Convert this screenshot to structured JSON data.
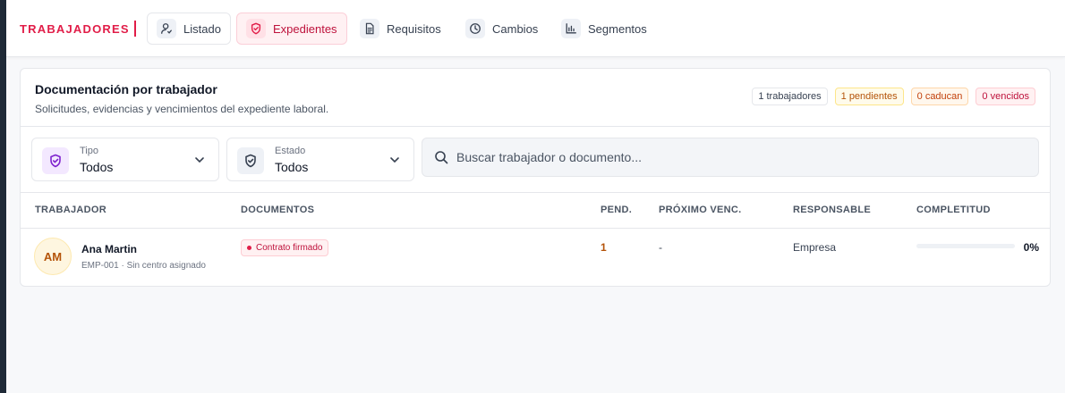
{
  "nav": {
    "brand": "TRABAJADORES",
    "tabs": [
      {
        "label": "Listado",
        "icon": "user-check-icon"
      },
      {
        "label": "Expedientes",
        "icon": "shield-icon",
        "active": true
      },
      {
        "label": "Requisitos",
        "icon": "document-icon"
      },
      {
        "label": "Cambios",
        "icon": "clock-icon"
      },
      {
        "label": "Segmentos",
        "icon": "bar-chart-icon"
      }
    ]
  },
  "card": {
    "title": "Documentación por trabajador",
    "subtitle": "Solicitudes, evidencias y vencimientos del expediente laboral.",
    "badges": {
      "workers": "1 trabajadores",
      "pending": "1 pendientes",
      "expiring": "0 caducan",
      "expired": "0 vencidos"
    }
  },
  "filters": {
    "tipo": {
      "label": "Tipo",
      "value": "Todos"
    },
    "estado": {
      "label": "Estado",
      "value": "Todos"
    },
    "search_placeholder": "Buscar trabajador o documento..."
  },
  "table": {
    "headers": {
      "worker": "TRABAJADOR",
      "documents": "DOCUMENTOS",
      "pending": "PEND.",
      "next_due": "PRÓXIMO VENC.",
      "responsible": "RESPONSABLE",
      "completeness": "COMPLETITUD"
    },
    "rows": [
      {
        "initials": "AM",
        "name": "Ana Martin",
        "sub": "EMP-001 · Sin centro asignado",
        "document": "Contrato firmado",
        "pending": "1",
        "next_due": "-",
        "responsible": "Empresa",
        "completeness_pct": 0,
        "completeness_label": "0%"
      }
    ]
  },
  "colors": {
    "accent": "#e11d48",
    "sidebar": "#1f2a37"
  }
}
